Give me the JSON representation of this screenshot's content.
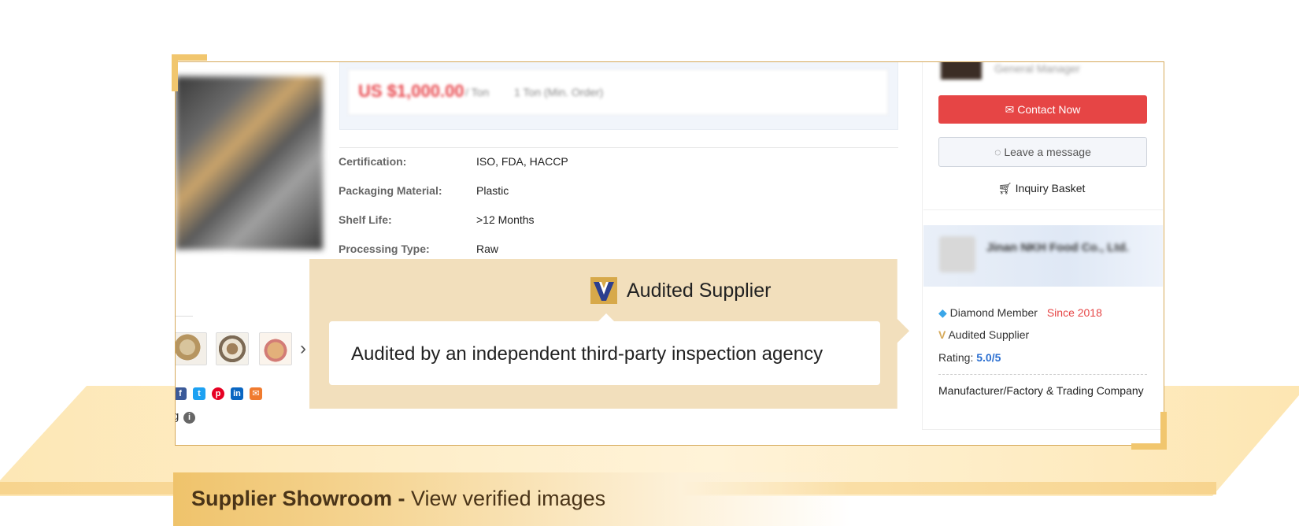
{
  "price": {
    "value": "US $1,000.00",
    "unit": "/ Ton",
    "moq": "1 Ton (Min. Order)"
  },
  "specs": [
    {
      "label": "Certification:",
      "value": "ISO, FDA, HACCP"
    },
    {
      "label": "Packaging Material:",
      "value": "Plastic"
    },
    {
      "label": "Shelf Life:",
      "value": ">12 Months"
    },
    {
      "label": "Processing Type:",
      "value": "Raw"
    }
  ],
  "contact": {
    "rep_title": "General Manager",
    "contact_now": "Contact Now",
    "leave_message": "Leave a message",
    "inquiry_basket": "Inquiry Basket"
  },
  "company": {
    "name": "Jinan NKH Food Co., Ltd.",
    "member": "Diamond Member",
    "since": "Since 2018",
    "audited": "Audited Supplier",
    "rating_label": "Rating:",
    "rating_value": "5.0/5",
    "business_type": "Manufacturer/Factory & Trading Company"
  },
  "share": {
    "left_partial": "g",
    "info": "i"
  },
  "tooltip": {
    "title": "Audited Supplier",
    "text": "Audited by an independent third-party inspection agency"
  },
  "caption": {
    "bold": "Supplier Showroom - ",
    "normal": "View verified images"
  },
  "colors": {
    "accent_red": "#e64545",
    "gold": "#d5a95a",
    "rating_blue": "#2b6fd1",
    "tooltip_bg": "#f2dfbc"
  }
}
